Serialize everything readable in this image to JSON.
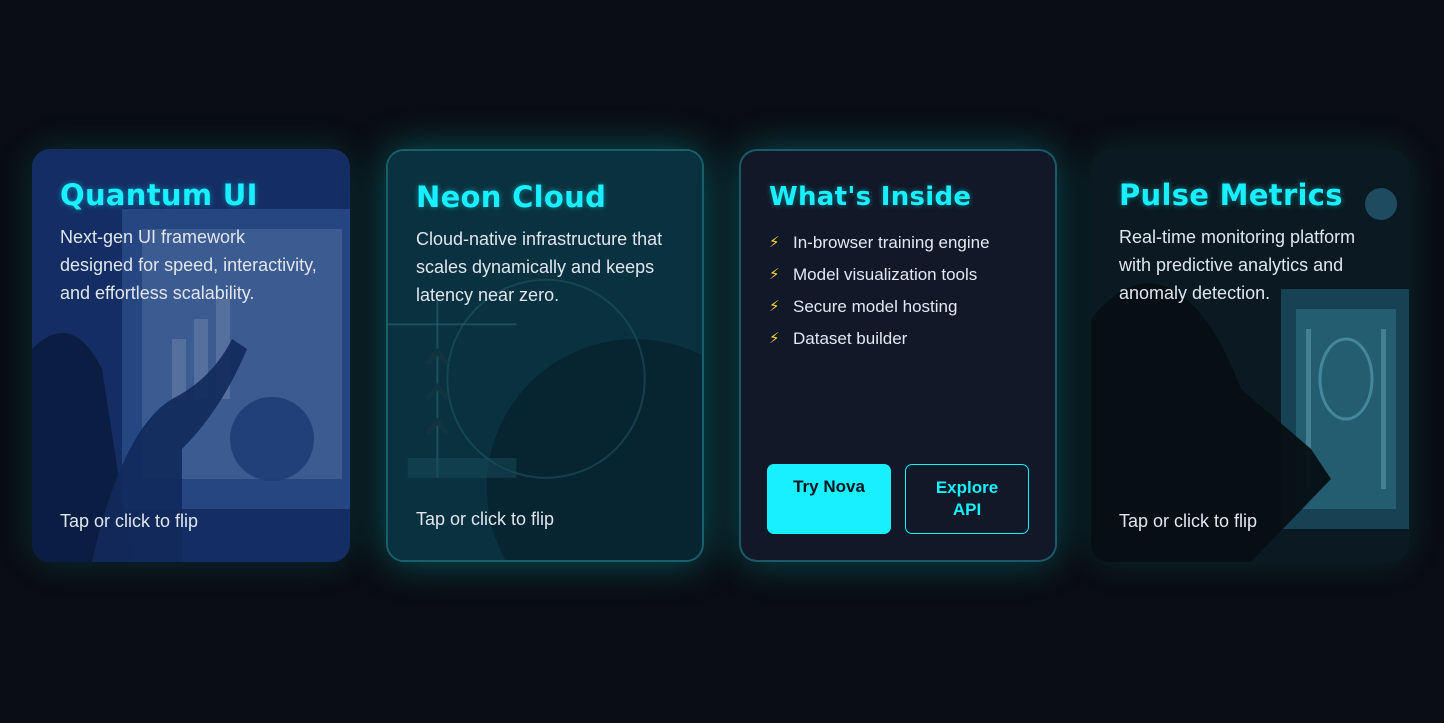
{
  "cards": [
    {
      "title": "Quantum UI",
      "description": "Next-gen UI framework designed for speed, interactivity, and effortless scalability.",
      "flip_hint": "Tap or click to flip"
    },
    {
      "title": "Neon Cloud",
      "description": "Cloud-native infrastructure that scales dynamically and keeps latency near zero.",
      "flip_hint": "Tap or click to flip"
    },
    {
      "title": "What's Inside",
      "features": [
        "In-browser training engine",
        "Model visualization tools",
        "Secure model hosting",
        "Dataset builder"
      ],
      "feature_icon": "lightning-bolt-icon",
      "primary_button": "Try Nova",
      "secondary_button": "Explore API"
    },
    {
      "title": "Pulse Metrics",
      "description": "Real-time monitoring platform with predictive analytics and anomaly detection.",
      "flip_hint": "Tap or click to flip"
    }
  ],
  "colors": {
    "accent": "#19f0ff",
    "background": "#0a0d13",
    "card_back": "#111827",
    "bolt": "#ffd23a"
  }
}
